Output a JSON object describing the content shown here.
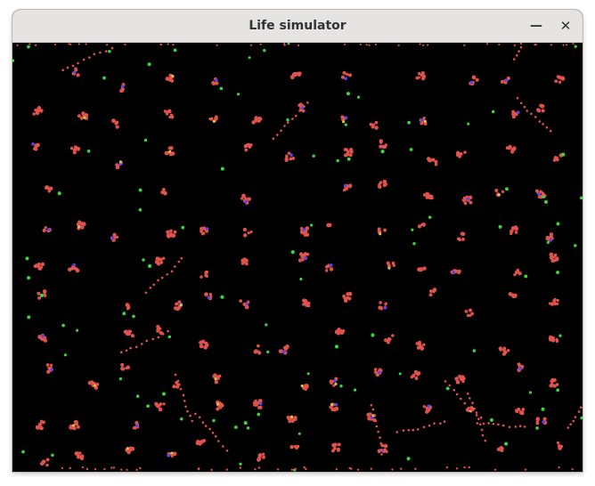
{
  "window": {
    "title": "Life simulator",
    "minimize_glyph": "—",
    "close_glyph": "✕"
  },
  "simulation": {
    "background_color": "#000000",
    "particle_types": [
      {
        "name": "red",
        "color": "#e0524a"
      },
      {
        "name": "green",
        "color": "#3ad83a"
      },
      {
        "name": "blue",
        "color": "#5a46e8"
      },
      {
        "name": "yellow",
        "color": "#d8c23a"
      }
    ]
  }
}
